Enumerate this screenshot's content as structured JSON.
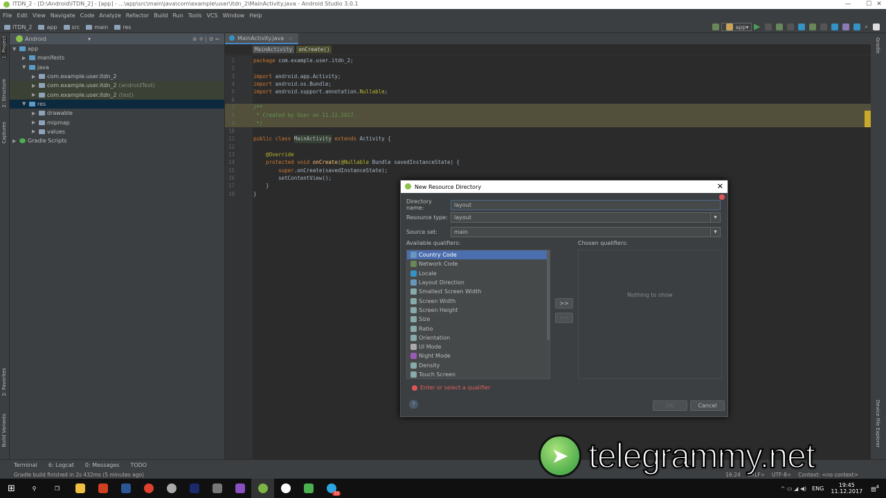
{
  "window": {
    "title": "ITDN_2 - [D:\\Android\\ITDN_2] - [app] - ...\\app\\src\\main\\java\\com\\example\\user\\itdn_2\\MainActivity.java - Android Studio 3.0.1"
  },
  "menu": [
    "File",
    "Edit",
    "View",
    "Navigate",
    "Code",
    "Analyze",
    "Refactor",
    "Build",
    "Run",
    "Tools",
    "VCS",
    "Window",
    "Help"
  ],
  "nav": {
    "crumbs": [
      "ITDN_2",
      "app",
      "src",
      "main",
      "res"
    ],
    "run_config": "app"
  },
  "stripes": {
    "left": [
      "1: Project",
      "2: Structure",
      "Captures",
      "2: Favorites",
      "Build Variants"
    ],
    "right": [
      "Gradle",
      "Device File Explorer"
    ]
  },
  "project": {
    "view": "Android",
    "tree": [
      {
        "label": "app",
        "depth": 0,
        "arrow": "▼"
      },
      {
        "label": "manifests",
        "depth": 1,
        "arrow": "▶"
      },
      {
        "label": "java",
        "depth": 1,
        "arrow": "▼"
      },
      {
        "label": "com.example.user.itdn_2",
        "depth": 2,
        "arrow": "▶",
        "suffix": ""
      },
      {
        "label": "com.example.user.itdn_2",
        "depth": 2,
        "arrow": "▶",
        "suffix": "(androidTest)"
      },
      {
        "label": "com.example.user.itdn_2",
        "depth": 2,
        "arrow": "▶",
        "suffix": "(test)"
      },
      {
        "label": "res",
        "depth": 1,
        "arrow": "▼"
      },
      {
        "label": "drawable",
        "depth": 2,
        "arrow": "▶"
      },
      {
        "label": "mipmap",
        "depth": 2,
        "arrow": "▶"
      },
      {
        "label": "values",
        "depth": 2,
        "arrow": "▶"
      },
      {
        "label": "Gradle Scripts",
        "depth": 0,
        "arrow": "▶"
      }
    ]
  },
  "editor": {
    "tab": "MainActivity.java",
    "breadcrumbs": [
      "MainActivity",
      "onCreate()"
    ],
    "lines": [
      [
        [
          "k",
          "package "
        ],
        [
          "t",
          "com.example.user.itdn_2;"
        ]
      ],
      [],
      [
        [
          "k",
          "import "
        ],
        [
          "t",
          "android.app.Activity;"
        ]
      ],
      [
        [
          "k",
          "import "
        ],
        [
          "t",
          "android.os.Bundle;"
        ]
      ],
      [
        [
          "k",
          "import "
        ],
        [
          "t",
          "android.support.annotation."
        ],
        [
          "a",
          "Nullable"
        ],
        [
          "t",
          ";"
        ]
      ],
      [],
      [
        [
          "cm",
          "/**"
        ]
      ],
      [
        [
          "cm",
          " * Created by User on 11.12.2017."
        ]
      ],
      [
        [
          "cm",
          " */"
        ]
      ],
      [],
      [
        [
          "k",
          "public class "
        ],
        [
          "hl",
          "MainActivity"
        ],
        [
          "k",
          " extends "
        ],
        [
          "t",
          "Activity {"
        ]
      ],
      [],
      [
        [
          "a",
          "    @Override"
        ]
      ],
      [
        [
          "k",
          "    protected void "
        ],
        [
          "mt",
          "onCreate"
        ],
        [
          "t",
          "("
        ],
        [
          "a",
          "@Nullable"
        ],
        [
          "t",
          " Bundle savedInstanceState) {"
        ]
      ],
      [
        [
          "k",
          "        super"
        ],
        [
          "t",
          ".onCreate(savedInstanceState);"
        ]
      ],
      [
        [
          "t",
          "        setContentView();"
        ]
      ],
      [
        [
          "t",
          "    }"
        ]
      ],
      [
        [
          "t",
          "}"
        ]
      ]
    ]
  },
  "dialog": {
    "title": "New Resource Directory",
    "directory_name_label": "Directory name:",
    "directory_name": "layout",
    "resource_type_label": "Resource type:",
    "resource_type": "layout",
    "source_set_label": "Source set:",
    "source_set": "main",
    "available_label": "Available qualifiers:",
    "chosen_label": "Chosen qualifiers:",
    "nothing": "Nothing to show",
    "add": ">>",
    "remove": "<<",
    "error": "Enter or select a qualifier",
    "ok": "OK",
    "cancel": "Cancel",
    "help": "?",
    "qualifiers": [
      "Country Code",
      "Network Code",
      "Locale",
      "Layout Direction",
      "Smallest Screen Width",
      "Screen Width",
      "Screen Height",
      "Size",
      "Ratio",
      "Orientation",
      "UI Mode",
      "Night Mode",
      "Density",
      "Touch Screen"
    ]
  },
  "bottom_tools": [
    "Terminal",
    "6: Logcat",
    "0: Messages",
    "TODO"
  ],
  "status": {
    "message": "Gradle build finished in 2s 432ms (5 minutes ago)",
    "position": "16:24",
    "line_sep": "CRLF÷",
    "encoding": "UTF-8÷",
    "context": "Context: <no context>"
  },
  "taskbar": {
    "lang": "ENG",
    "time": "19:45",
    "date": "11.12.2017",
    "notifications": "4",
    "telegram_badge": "32"
  },
  "watermark": "telegrammy.net"
}
